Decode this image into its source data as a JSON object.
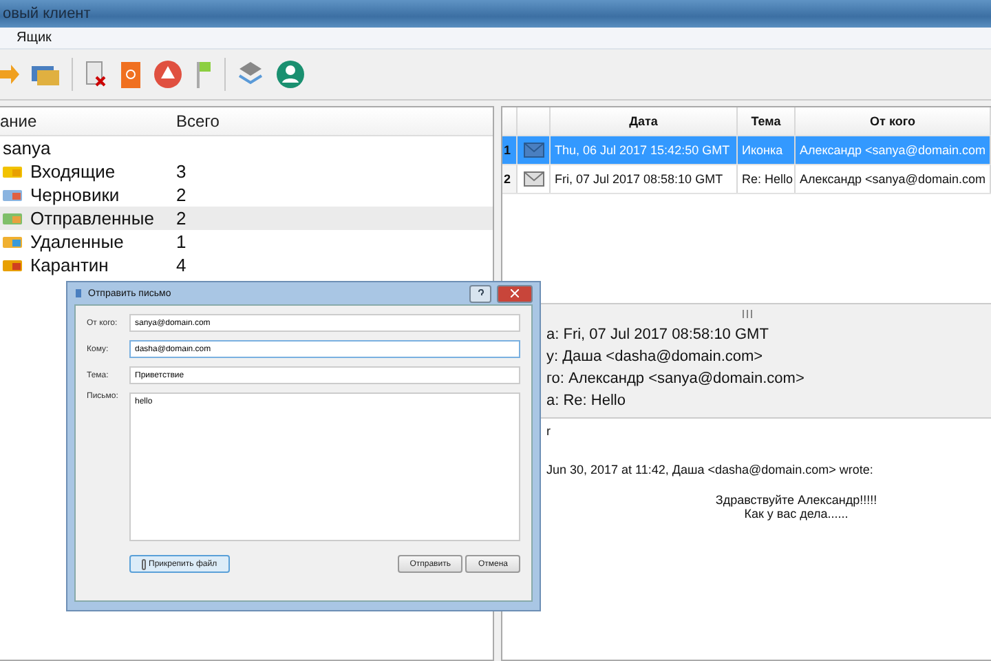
{
  "window": {
    "title": "овый клиент"
  },
  "menu": [
    "Ящик"
  ],
  "folders": {
    "columns": [
      "ание",
      "Всего"
    ],
    "account": "sanya",
    "items": [
      {
        "name": "Входящие",
        "count": "3",
        "selected": false
      },
      {
        "name": "Черновики",
        "count": "2",
        "selected": false
      },
      {
        "name": "Отправленные",
        "count": "2",
        "selected": true
      },
      {
        "name": "Удаленные",
        "count": "1",
        "selected": false
      },
      {
        "name": "Карантин",
        "count": "4",
        "selected": false
      }
    ]
  },
  "messages": {
    "columns": [
      "Дата",
      "Тема",
      "От кого"
    ],
    "rows": [
      {
        "number": "1",
        "date": "Thu, 06 Jul 2017 15:42:50 GMT",
        "subject": "Иконка",
        "from": "Александр <sanya@domain.com",
        "selected": true
      },
      {
        "number": "2",
        "date": "Fri, 07 Jul 2017 08:58:10 GMT",
        "subject": "Re: Hello",
        "from": "Александр <sanya@domain.com",
        "selected": false
      }
    ]
  },
  "preview": {
    "header_lines": [
      "а: Fri, 07 Jul 2017 08:58:10 GMT",
      "у: Даша  <dasha@domain.com>",
      "го: Александр <sanya@domain.com>",
      "а: Re: Hello"
    ],
    "lines": [
      "r",
      "Jun 30, 2017 at 11:42, Даша <dasha@domain.com> wrote:"
    ],
    "quote": [
      "Здравствуйте Александр!!!!!",
      "Как у вас дела......"
    ]
  },
  "dialog": {
    "title": "Отправить письмо",
    "fields": [
      {
        "label": "От кого:",
        "value": "sanya@domain.com"
      },
      {
        "label": "Кому:",
        "value": "dasha@domain.com"
      },
      {
        "label": "Тема:",
        "value": "Приветствие"
      }
    ],
    "message": {
      "label": "Письмо:",
      "value": "hello"
    },
    "buttons": [
      {
        "label": "Прикрепить файл",
        "kind": "attach"
      },
      {
        "label": "Отправить",
        "kind": "action"
      },
      {
        "label": "Отмена",
        "kind": "action"
      }
    ]
  }
}
